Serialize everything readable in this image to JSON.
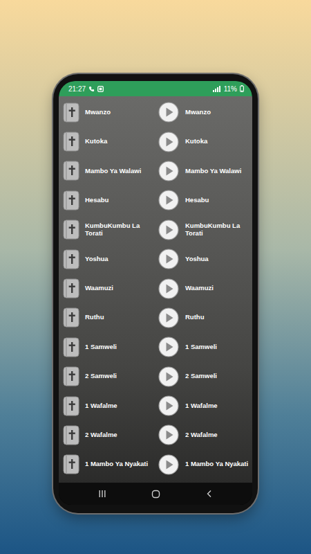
{
  "status_bar": {
    "time": "21:27",
    "battery": "11%"
  },
  "books": [
    {
      "text_label": "Mwanzo",
      "audio_label": "Mwanzo"
    },
    {
      "text_label": "Kutoka",
      "audio_label": "Kutoka"
    },
    {
      "text_label": "Mambo Ya Walawi",
      "audio_label": "Mambo Ya Walawi"
    },
    {
      "text_label": "Hesabu",
      "audio_label": "Hesabu"
    },
    {
      "text_label": "KumbuKumbu La Torati",
      "audio_label": "KumbuKumbu La Torati"
    },
    {
      "text_label": "Yoshua",
      "audio_label": "Yoshua"
    },
    {
      "text_label": "Waamuzi",
      "audio_label": "Waamuzi"
    },
    {
      "text_label": "Ruthu",
      "audio_label": "Ruthu"
    },
    {
      "text_label": "1 Samweli",
      "audio_label": "1 Samweli"
    },
    {
      "text_label": "2 Samweli",
      "audio_label": "2 Samweli"
    },
    {
      "text_label": "1 Wafalme",
      "audio_label": "1 Wafalme"
    },
    {
      "text_label": "2 Wafalme",
      "audio_label": "2 Wafalme"
    },
    {
      "text_label": "1 Mambo Ya Nyakati",
      "audio_label": "1 Mambo Ya Nyakati"
    }
  ]
}
